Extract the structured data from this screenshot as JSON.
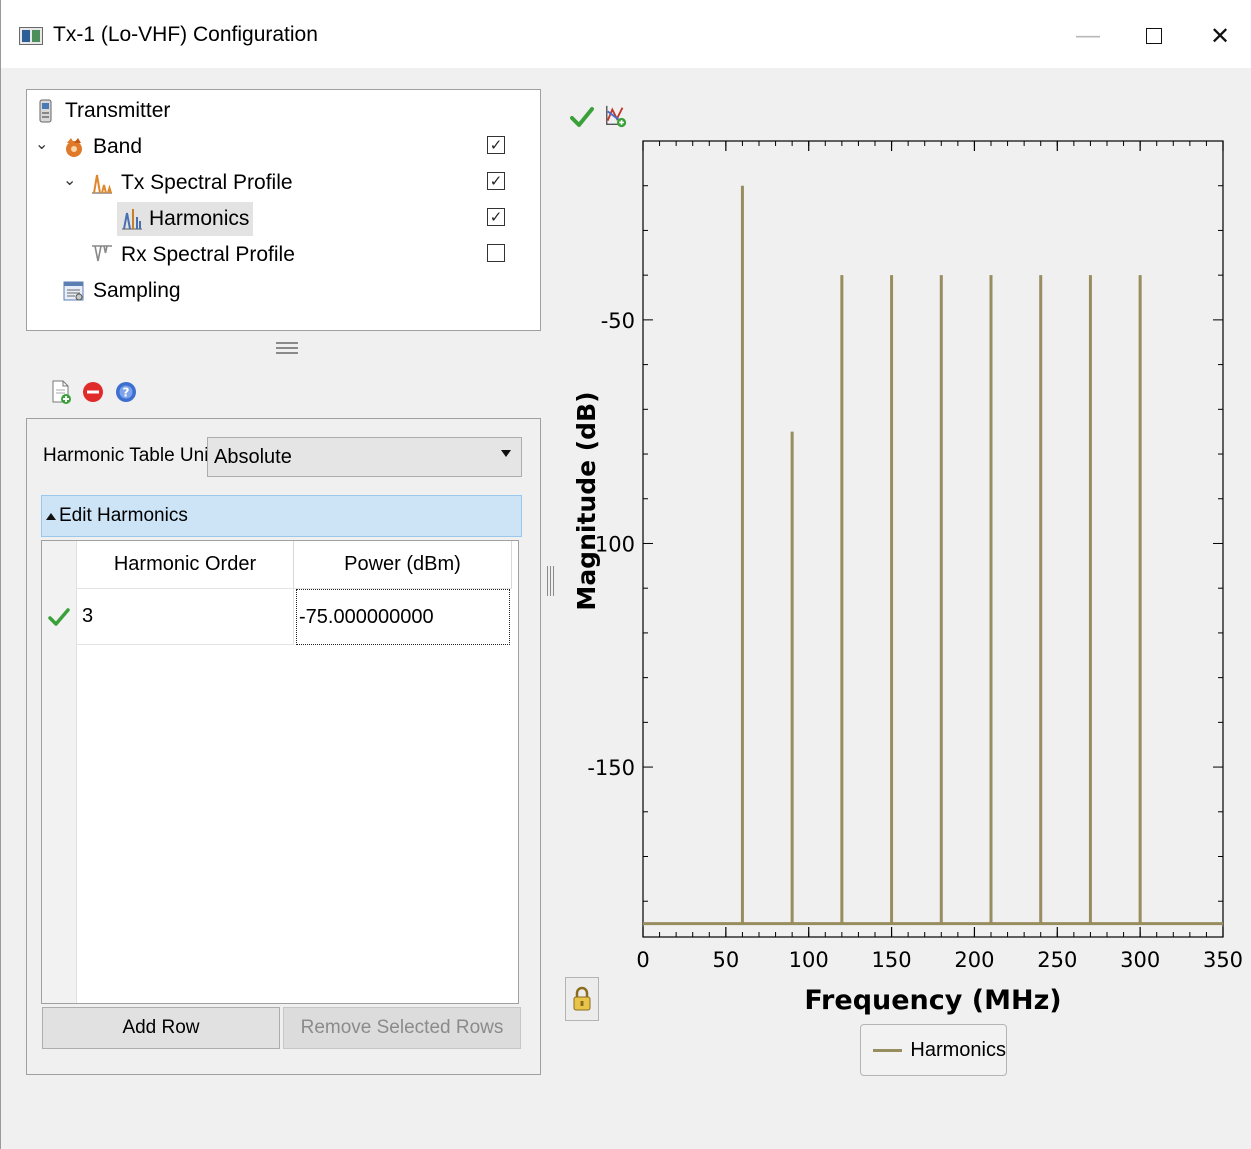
{
  "window": {
    "title": "Tx-1 (Lo-VHF) Configuration"
  },
  "tree": {
    "items": [
      {
        "label": "Transmitter",
        "checked": null,
        "expanded": null,
        "selected": false
      },
      {
        "label": "Band",
        "checked": true,
        "expanded": true,
        "selected": false
      },
      {
        "label": "Tx Spectral Profile",
        "checked": true,
        "expanded": true,
        "selected": false
      },
      {
        "label": "Harmonics",
        "checked": true,
        "expanded": null,
        "selected": true
      },
      {
        "label": "Rx Spectral Profile",
        "checked": false,
        "expanded": null,
        "selected": false
      },
      {
        "label": "Sampling",
        "checked": null,
        "expanded": null,
        "selected": false
      }
    ]
  },
  "toolbar": {
    "icons": [
      "add-document-icon",
      "remove-icon",
      "help-icon"
    ]
  },
  "harmonics": {
    "units_label": "Harmonic Table Units",
    "units_value": "Absolute",
    "section_label": "Edit Harmonics",
    "columns": [
      "Harmonic Order",
      "Power (dBm)"
    ],
    "rows": [
      {
        "order": "3",
        "power": "-75.000000000",
        "valid": true
      }
    ],
    "add_row_label": "Add Row",
    "remove_rows_label": "Remove Selected Rows"
  },
  "chart_toolbar": {
    "icons": [
      "apply-check-icon",
      "chart-settings-icon"
    ]
  },
  "chart_data": {
    "type": "bar",
    "xlabel": "Frequency (MHz)",
    "ylabel": "Magnitude (dB)",
    "xlim": [
      0,
      350
    ],
    "ylim": [
      -188,
      -10
    ],
    "x_ticks": [
      "0",
      "50",
      "100",
      "150",
      "200",
      "250",
      "300",
      "350"
    ],
    "y_ticks": [
      "-50",
      "-100",
      "-150"
    ],
    "baseline": -185,
    "series": [
      {
        "name": "Harmonics",
        "color": "#978d5f",
        "points": [
          {
            "x": 60,
            "y": -20
          },
          {
            "x": 90,
            "y": -75
          },
          {
            "x": 120,
            "y": -40
          },
          {
            "x": 150,
            "y": -40
          },
          {
            "x": 180,
            "y": -40
          },
          {
            "x": 210,
            "y": -40
          },
          {
            "x": 240,
            "y": -40
          },
          {
            "x": 270,
            "y": -40
          },
          {
            "x": 300,
            "y": -40
          }
        ]
      }
    ],
    "legend": "bottom-center",
    "grid": false
  },
  "colors": {
    "accent": "#cde4f7",
    "series": "#978d5f",
    "check": "#3aa13a",
    "remove": "#e02b2b",
    "help": "#3d6fd1"
  }
}
